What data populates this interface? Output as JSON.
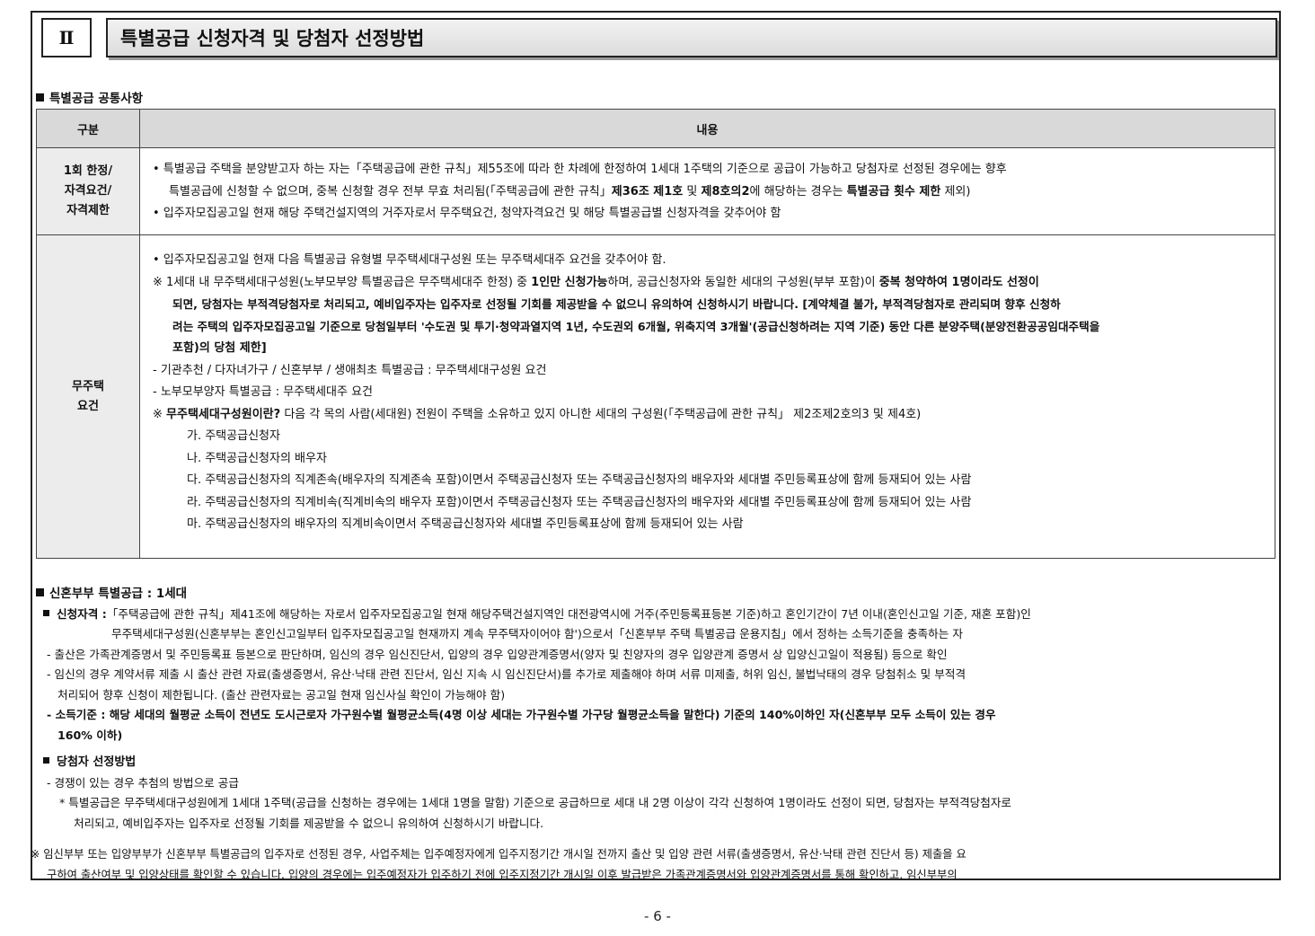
{
  "section": {
    "number": "Ⅱ",
    "title": "특별공급 신청자격 및 당첨자 선정방법"
  },
  "common": {
    "heading": "특별공급 공통사항",
    "table": {
      "col_category": "구분",
      "col_content": "내용",
      "row1": {
        "category": [
          "1회 한정/",
          "자격요건/",
          "자격제한"
        ],
        "l1": "• 특별공급 주택을 분양받고자 하는 자는「주택공급에 관한 규칙」제55조에 따라 한 차례에 한정하여 1세대 1주택의 기준으로 공급이 가능하고 당첨자로 선정된 경우에는 향후",
        "l2a": "특별공급에 신청할 수 없으며, 중복 신청할 경우 전부 무효 처리됨(「주택공급에 관한 규칙」",
        "l2b": "제36조 제1호",
        "l2c": " 및 ",
        "l2d": "제8호의2",
        "l2e": "에 해당하는 경우는 ",
        "l2f": "특별공급 횟수 제한",
        "l2g": " 제외)",
        "l3": "• 입주자모집공고일 현재 해당 주택건설지역의 거주자로서 무주택요건, 청약자격요건 및 해당 특별공급별 신청자격을 갖추어야 함"
      },
      "row2": {
        "category": [
          "무주택",
          "요건"
        ],
        "l1": "• 입주자모집공고일 현재 다음 특별공급 유형별 무주택세대구성원 또는 무주택세대주 요건을 갖추어야 함.",
        "l2a": "※ 1세대 내 무주택세대구성원(노부모부양 특별공급은 무주택세대주 한정) 중 ",
        "l2b": "1인만 신청가능",
        "l2c": "하며, 공급신청자와 동일한 세대의 구성원(부부 포함)이 ",
        "l2d": "중복 청약하여 1명이라도 선정이",
        "l3": "되면, 당첨자는 부적격당첨자로 처리되고, 예비입주자는 입주자로 선정될 기회를 제공받을 수 없으니 유의하여 신청하시기 바랍니다. [계약체결 불가, 부적격당첨자로 관리되며 향후 신청하",
        "l4": "려는 주택의 입주자모집공고일 기준으로 당첨일부터 '수도권 및 투기·청약과열지역 1년, 수도권외 6개월, 위축지역 3개월'(공급신청하려는 지역 기준) 동안 다른 분양주택(분양전환공공임대주택을",
        "l5": "포함)의 당첨 제한]",
        "l6": "- 기관추천 / 다자녀가구 / 신혼부부 / 생애최초 특별공급 : 무주택세대구성원 요건",
        "l7": "- 노부모부양자 특별공급 : 무주택세대주 요건",
        "l8a": "※ ",
        "l8b": "무주택세대구성원이란?",
        "l8c": " 다음 각 목의 사람(세대원) 전원이 주택을 소유하고 있지 아니한 세대의 구성원(「주택공급에 관한 규칙」 제2조제2호의3 및 제4호)",
        "list": [
          "가. 주택공급신청자",
          "나. 주택공급신청자의 배우자",
          "다. 주택공급신청자의 직계존속(배우자의 직계존속 포함)이면서 주택공급신청자 또는 주택공급신청자의 배우자와 세대별 주민등록표상에 함께 등재되어 있는 사람",
          "라. 주택공급신청자의 직계비속(직계비속의 배우자 포함)이면서 주택공급신청자 또는 주택공급신청자의 배우자와 세대별 주민등록표상에 함께 등재되어 있는 사람",
          "마. 주택공급신청자의 배우자의 직계비속이면서 주택공급신청자와 세대별 주민등록표상에 함께 등재되어 있는 사람"
        ]
      }
    }
  },
  "newlywed": {
    "heading": "신혼부부 특별공급 : 1세대",
    "qual_label": "신청자격 :",
    "qual_l1": "「주택공급에 관한 규칙」제41조에 해당하는 자로서 입주자모집공고일 현재 해당주택건설지역인 대전광역시에 거주(주민등록표등본 기준)하고 혼인기간이 7년 이내(혼인신고일 기준, 재혼 포함)인",
    "qual_l2": "무주택세대구성원(신혼부부는 혼인신고일부터 입주자모집공고일 현재까지 계속 무주택자이어야 함')으로서「신혼부부 주택 특별공급 운용지침」에서 정하는 소득기준을 충족하는 자",
    "birth": "- 출산은 가족관계증명서 및 주민등록표 등본으로 판단하며, 임신의 경우 임신진단서, 입양의 경우 입양관계증명서(양자 및 친양자의 경우 입양관계 증명서 상 입양신고일이 적용됨) 등으로 확인",
    "preg_l1": "- 임신의 경우 계약서류 제출 시 출산 관련 자료(출생증명서, 유산·낙태 관련 진단서, 임신 지속 시 임신진단서)를 추가로 제출해야 하며 서류 미제출, 허위 임신, 불법낙태의 경우 당첨취소 및 부적격",
    "preg_l2": "처리되어 향후 신청이 제한됩니다. (출산 관련자료는 공고일 현재 임신사실 확인이 가능해야 함)",
    "income_l1": "- 소득기준 : 해당 세대의 월평균 소득이 전년도 도시근로자 가구원수별 월평균소득(4명 이상 세대는 가구원수별 가구당 월평균소득을 말한다) 기준의 140%이하인 자(신혼부부 모두 소득이 있는 경우",
    "income_l2": "160% 이하)",
    "select_heading": "당첨자 선정방법",
    "select_l1": "- 경쟁이 있는 경우 추첨의 방법으로 공급",
    "select_l2": "* 특별공급은 무주택세대구성원에게 1세대 1주택(공급을 신청하는 경우에는 1세대 1명을 말함) 기준으로 공급하므로 세대 내 2명 이상이 각각 신청하여 1명이라도 선정이 되면, 당첨자는 부적격당첨자로",
    "select_l3": "처리되고, 예비입주자는 입주자로 선정될 기회를 제공받을 수 없으니 유의하여 신청하시기 바랍니다.",
    "note_l1": "※ 임신부부 또는 입양부부가 신혼부부 특별공급의 입주자로 선정된 경우, 사업주체는 입주예정자에게 입주지정기간 개시일 전까지 출산 및 입양 관련 서류(출생증명서, 유산·낙태 관련 진단서 등) 제출을 요",
    "note_l2": "구하여 출산여부 및 입양상태를 확인할 수 있습니다. 입양의 경우에는 입주예정자가 입주하기 전에 입주지정기간 개시일 이후 발급받은 가족관계증명서와 입양관계증명서를 통해 확인하고, 임신부부의"
  },
  "page_number": "- 6 -"
}
